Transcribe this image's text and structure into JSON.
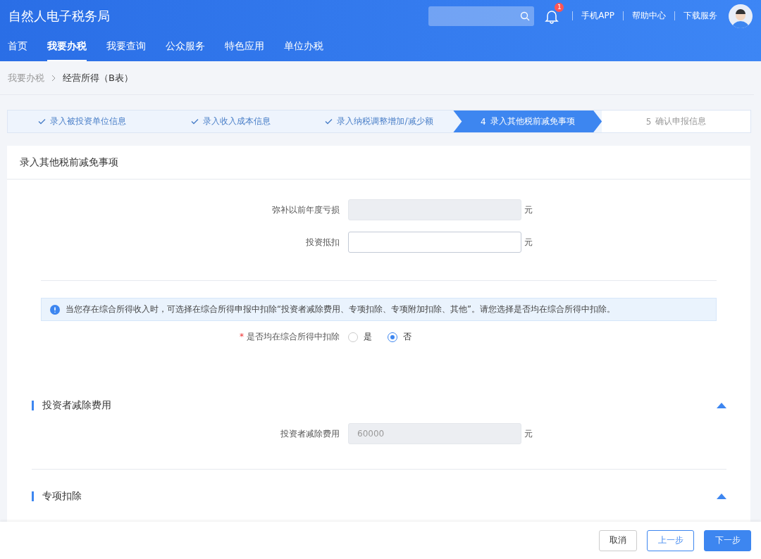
{
  "header": {
    "title": "自然人电子税务局",
    "notification_count": "1",
    "links": [
      "手机APP",
      "帮助中心",
      "下载服务"
    ]
  },
  "nav": [
    {
      "label": "首页",
      "selected": false
    },
    {
      "label": "我要办税",
      "selected": true
    },
    {
      "label": "我要查询",
      "selected": false
    },
    {
      "label": "公众服务",
      "selected": false
    },
    {
      "label": "特色应用",
      "selected": false
    },
    {
      "label": "单位办税",
      "selected": false
    }
  ],
  "breadcrumb": [
    "我要办税",
    "经营所得（B表）"
  ],
  "steps": [
    {
      "label": "录入被投资单位信息",
      "done": true,
      "selected": false
    },
    {
      "label": "录入收入成本信息",
      "done": true,
      "selected": false
    },
    {
      "label": "录入纳税调整增加/减少额",
      "done": true,
      "selected": false
    },
    {
      "number": "4",
      "label": "录入其他税前减免事项",
      "done": false,
      "selected": true
    },
    {
      "number": "5",
      "label": "确认申报信息",
      "done": false,
      "selected": false
    }
  ],
  "panel": {
    "title": "录入其他税前减免事项",
    "fields": [
      {
        "label": "弥补以前年度亏损",
        "disabled": true,
        "unit": "元"
      },
      {
        "label": "投资抵扣",
        "disabled": false,
        "unit": "元"
      }
    ],
    "notice": "当您存在综合所得收入时，可选择在综合所得申报中扣除“投资者减除费用、专项扣除、专项附加扣除、其他”。请您选择是否均在综合所得中扣除。",
    "question": {
      "label": "是否均在综合所得中扣除",
      "required_mark": "*",
      "options": [
        {
          "label": "是",
          "selected": false
        },
        {
          "label": "否",
          "selected": true
        }
      ]
    },
    "sections": [
      {
        "title": "投资者减除费用",
        "expanded": true,
        "fields": [
          {
            "label": "投资者减除费用",
            "value": "60000",
            "disabled": true,
            "unit": "元"
          }
        ]
      },
      {
        "title": "专项扣除",
        "expanded": true
      }
    ]
  },
  "footer": {
    "buttons": [
      {
        "label": "取消",
        "kind": "default"
      },
      {
        "label": "上一步",
        "kind": "outline"
      },
      {
        "label": "下一步",
        "kind": "primary"
      }
    ]
  }
}
